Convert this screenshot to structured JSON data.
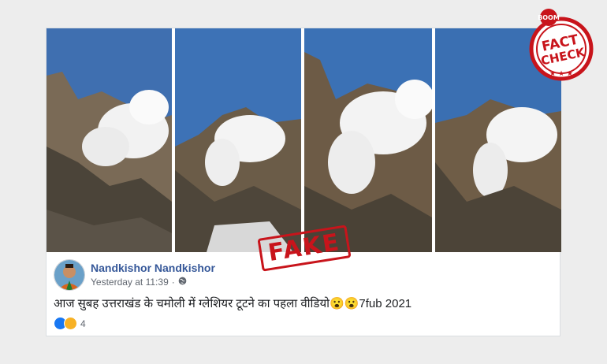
{
  "stamp": {
    "fake_label": "FAKE"
  },
  "badge": {
    "top_text": "BOOM",
    "line1": "FACT",
    "line2": "CHECK"
  },
  "post": {
    "author": "Nandkishor Nandkishor",
    "timestamp": "Yesterday at 11:39",
    "privacy_icon": "globe-icon",
    "text": "आज सुबह उत्तराखंड के चमोली में ग्लेशियर टूटने का पहला वीडियो😮😮7fub 2021",
    "reaction_icons": [
      "like-icon",
      "sad-icon"
    ],
    "reaction_count": "4"
  },
  "colors": {
    "stamp_red": "#c8141b",
    "link_blue": "#365899",
    "sky": "#3c6fb3"
  }
}
